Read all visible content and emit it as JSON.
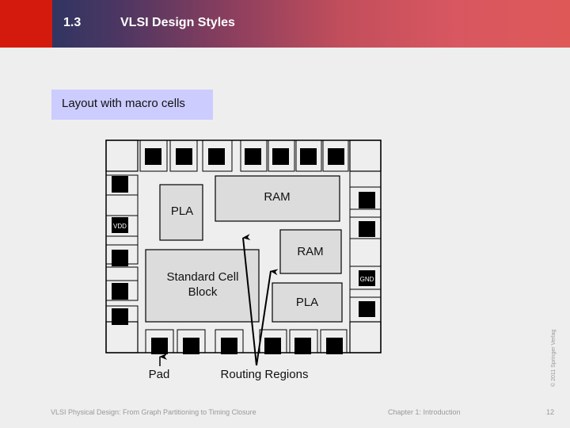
{
  "header": {
    "section_number": "1.3",
    "section_title": "VLSI Design Styles",
    "accent_color": "#d41a0c"
  },
  "subtitle": "Layout with macro cells",
  "diagram": {
    "blocks": {
      "pla_top": "PLA",
      "ram_top": "RAM",
      "ram_right": "RAM",
      "standard_cell": [
        "Standard Cell",
        "Block"
      ],
      "pla_bottom": "PLA"
    },
    "pads": {
      "vdd": "VDD",
      "gnd": "GND"
    },
    "callouts": {
      "pad": "Pad",
      "routing_regions": "Routing Regions"
    }
  },
  "copyright": "© 2011 Springer Verlag",
  "footer": {
    "book_title": "VLSI Physical Design: From Graph Partitioning to Timing Closure",
    "chapter": "Chapter 1: Introduction",
    "page_number": "12"
  }
}
